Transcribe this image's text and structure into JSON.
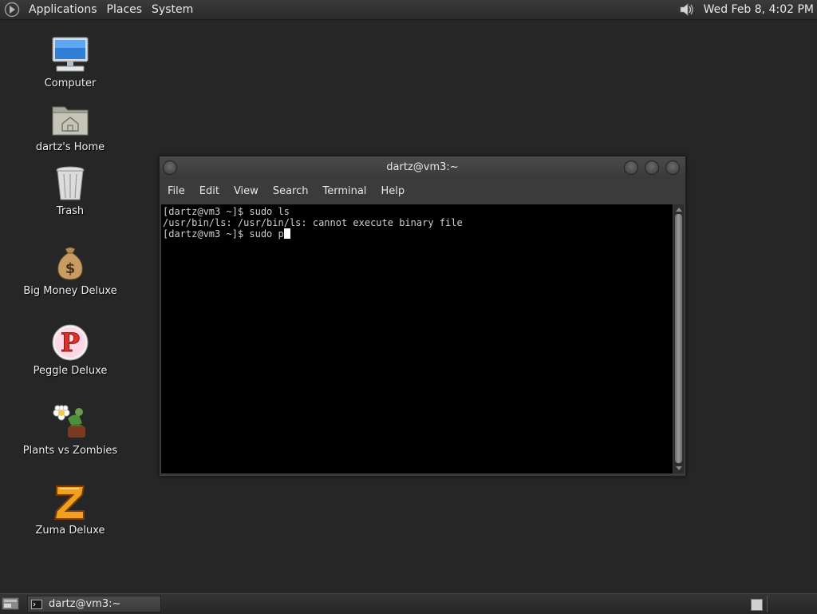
{
  "top_panel": {
    "menus": [
      "Applications",
      "Places",
      "System"
    ],
    "clock": "Wed Feb  8,  4:02 PM",
    "logo_icon": "distro-logo-icon",
    "volume_icon": "speaker-icon"
  },
  "desktop": {
    "icons": [
      {
        "label": "Computer",
        "icon": "computer-icon"
      },
      {
        "label": "dartz's Home",
        "icon": "home-folder-icon"
      },
      {
        "label": "Trash",
        "icon": "trash-icon"
      },
      {
        "label": "Big Money Deluxe",
        "icon": "money-bag-icon"
      },
      {
        "label": "Peggle Deluxe",
        "icon": "peggle-icon"
      },
      {
        "label": "Plants vs Zombies",
        "icon": "plants-vs-zombies-icon"
      },
      {
        "label": "Zuma Deluxe",
        "icon": "zuma-icon"
      }
    ]
  },
  "terminal": {
    "title": "dartz@vm3:~",
    "menu": [
      "File",
      "Edit",
      "View",
      "Search",
      "Terminal",
      "Help"
    ],
    "lines": [
      "[dartz@vm3 ~]$ sudo ls",
      "/usr/bin/ls: /usr/bin/ls: cannot execute binary file",
      "[dartz@vm3 ~]$ sudo p"
    ]
  },
  "taskbar": {
    "tasks": [
      {
        "label": "dartz@vm3:~",
        "icon": "terminal-icon"
      }
    ]
  }
}
